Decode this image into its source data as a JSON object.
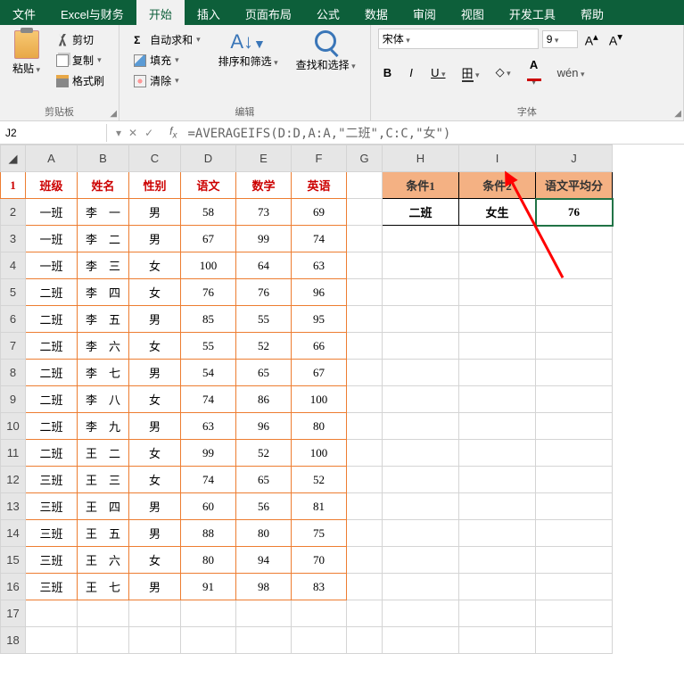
{
  "tabs": {
    "file": "文件",
    "excel_finance": "Excel与财务",
    "home": "开始",
    "insert": "插入",
    "page_layout": "页面布局",
    "formulas": "公式",
    "data": "数据",
    "review": "审阅",
    "view": "视图",
    "dev_tools": "开发工具",
    "help": "帮助"
  },
  "ribbon": {
    "clipboard": {
      "title": "剪贴板",
      "paste": "粘贴",
      "cut": "剪切",
      "copy": "复制",
      "format_painter": "格式刷"
    },
    "editing": {
      "title": "编辑",
      "autosum": "自动求和",
      "fill": "填充",
      "clear": "清除",
      "sort_filter": "排序和筛选",
      "find_select": "查找和选择"
    },
    "font": {
      "title": "字体",
      "name": "宋体",
      "size": "9",
      "bold": "B",
      "italic": "I",
      "underline": "U",
      "wen": "wén"
    }
  },
  "namebox": "J2",
  "formula": "=AVERAGEIFS(D:D,A:A,\"二班\",C:C,\"女\")",
  "columns": [
    "A",
    "B",
    "C",
    "D",
    "E",
    "F",
    "G",
    "H",
    "I",
    "J"
  ],
  "headers": {
    "a": "班级",
    "b": "姓名",
    "c": "性别",
    "d": "语文",
    "e": "数学",
    "f": "英语"
  },
  "side_headers": {
    "h": "条件1",
    "i": "条件2",
    "j": "语文平均分"
  },
  "side_values": {
    "h": "二班",
    "i": "女生",
    "j": "76"
  },
  "rows": [
    {
      "a": "一班",
      "b": "李　一",
      "c": "男",
      "d": "58",
      "e": "73",
      "f": "69"
    },
    {
      "a": "一班",
      "b": "李　二",
      "c": "男",
      "d": "67",
      "e": "99",
      "f": "74"
    },
    {
      "a": "一班",
      "b": "李　三",
      "c": "女",
      "d": "100",
      "e": "64",
      "f": "63"
    },
    {
      "a": "二班",
      "b": "李　四",
      "c": "女",
      "d": "76",
      "e": "76",
      "f": "96"
    },
    {
      "a": "二班",
      "b": "李　五",
      "c": "男",
      "d": "85",
      "e": "55",
      "f": "95"
    },
    {
      "a": "二班",
      "b": "李　六",
      "c": "女",
      "d": "55",
      "e": "52",
      "f": "66"
    },
    {
      "a": "二班",
      "b": "李　七",
      "c": "男",
      "d": "54",
      "e": "65",
      "f": "67"
    },
    {
      "a": "二班",
      "b": "李　八",
      "c": "女",
      "d": "74",
      "e": "86",
      "f": "100"
    },
    {
      "a": "二班",
      "b": "李　九",
      "c": "男",
      "d": "63",
      "e": "96",
      "f": "80"
    },
    {
      "a": "二班",
      "b": "王　二",
      "c": "女",
      "d": "99",
      "e": "52",
      "f": "100"
    },
    {
      "a": "三班",
      "b": "王　三",
      "c": "女",
      "d": "74",
      "e": "65",
      "f": "52"
    },
    {
      "a": "三班",
      "b": "王　四",
      "c": "男",
      "d": "60",
      "e": "56",
      "f": "81"
    },
    {
      "a": "三班",
      "b": "王　五",
      "c": "男",
      "d": "88",
      "e": "80",
      "f": "75"
    },
    {
      "a": "三班",
      "b": "王　六",
      "c": "女",
      "d": "80",
      "e": "94",
      "f": "70"
    },
    {
      "a": "三班",
      "b": "王　七",
      "c": "男",
      "d": "91",
      "e": "98",
      "f": "83"
    }
  ]
}
